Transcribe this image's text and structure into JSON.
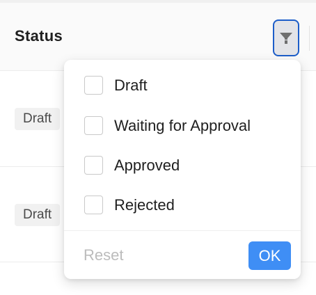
{
  "table": {
    "column_title": "Status",
    "rows": [
      {
        "status": "Draft"
      },
      {
        "status": "Draft"
      }
    ]
  },
  "filter": {
    "icon": "filter-funnel-icon",
    "active_border_color": "#1d5ec9",
    "options": [
      {
        "label": "Draft",
        "checked": false
      },
      {
        "label": "Waiting for Approval",
        "checked": false
      },
      {
        "label": "Approved",
        "checked": false
      },
      {
        "label": "Rejected",
        "checked": false
      }
    ],
    "reset_label": "Reset",
    "ok_label": "OK",
    "ok_color": "#3f8ef5"
  }
}
